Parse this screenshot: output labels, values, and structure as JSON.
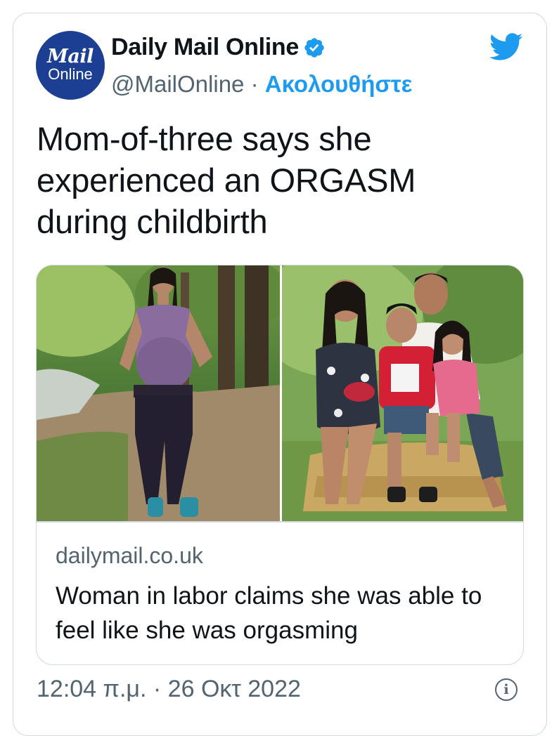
{
  "account": {
    "avatar_line1": "Mail",
    "avatar_line2": "Online",
    "display_name": "Daily Mail Online",
    "handle": "@MailOnline",
    "separator": "·",
    "follow_label": "Ακολουθήστε",
    "verified": true
  },
  "tweet": {
    "text": "Mom-of-three says she experienced an ORGASM during childbirth"
  },
  "link_card": {
    "domain": "dailymail.co.uk",
    "title": "Woman in labor claims she was able to feel like she was orgasming",
    "images": [
      "pregnant-woman-on-forest-path-photo",
      "family-on-hay-bale-photo"
    ]
  },
  "footer": {
    "timestamp": "12:04 π.μ. · 26 Οκτ 2022",
    "info_icon": "info-icon"
  },
  "colors": {
    "accent": "#1d9bf0",
    "secondary_text": "#536471",
    "avatar_bg": "#1c3f94",
    "border": "#cfd9de"
  }
}
